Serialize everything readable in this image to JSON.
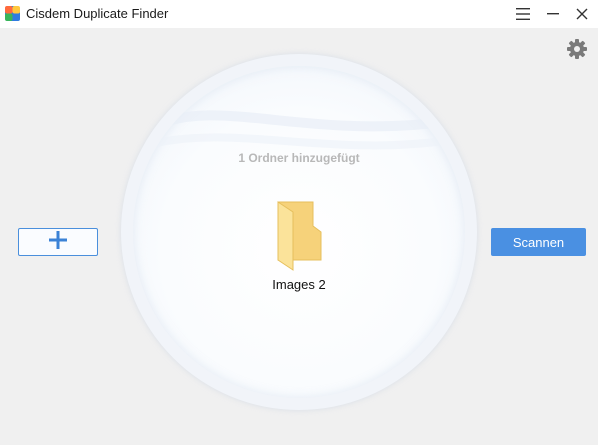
{
  "window": {
    "title": "Cisdem Duplicate Finder",
    "icons": [
      "app-logo-icon",
      "hamburger-menu-icon",
      "minimize-icon",
      "close-icon",
      "gear-icon"
    ]
  },
  "main": {
    "folder_count_text": "1 Ordner hinzugefügt",
    "folder": {
      "name": "Images 2",
      "icon": "folder-icon"
    },
    "add_button": {
      "icon": "plus-icon"
    },
    "scan_button": {
      "label": "Scannen"
    }
  },
  "colors": {
    "accent": "#4a90e2",
    "background": "#f0f0f0",
    "folder": "#f7d87a"
  }
}
